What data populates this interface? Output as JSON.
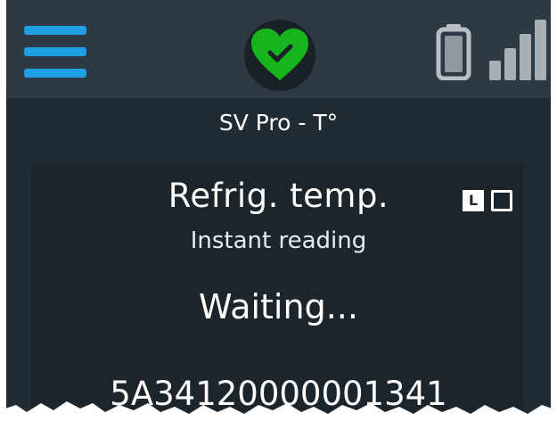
{
  "header": {
    "menu_icon": "hamburger-menu-icon",
    "status_icon": "heart-check-icon",
    "battery_icon": "battery-icon",
    "signal_icon": "signal-bars-icon",
    "colors": {
      "menu": "#1f9fe6",
      "status": "#17b51d"
    }
  },
  "device": {
    "name": "SV Pro - T°"
  },
  "reading": {
    "title": "Refrig. temp.",
    "subtitle": "Instant reading",
    "status": "Waiting...",
    "mode_label": "L",
    "serial": "5A34120000001341"
  }
}
